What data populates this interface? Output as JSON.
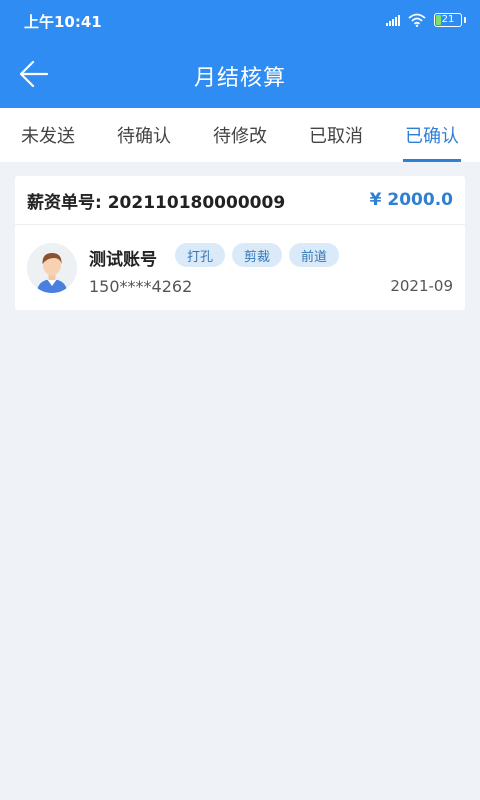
{
  "status_bar": {
    "time": "上午10:41",
    "battery": "21",
    "icons": [
      "signal-icon",
      "wifi-icon",
      "battery-icon"
    ],
    "battery_fill_fraction": 0.21
  },
  "header": {
    "title": "月结核算",
    "back_icon": "arrow-left-icon"
  },
  "tabs": [
    {
      "label": "未发送",
      "active": false
    },
    {
      "label": "待确认",
      "active": false
    },
    {
      "label": "待修改",
      "active": false
    },
    {
      "label": "已取消",
      "active": false
    },
    {
      "label": "已确认",
      "active": true
    }
  ],
  "records": [
    {
      "order_label": "薪资单号: 202110180000009",
      "amount": "¥ 2000.0",
      "user_name": "测试账号",
      "tags": [
        "打孔",
        "剪裁",
        "前道"
      ],
      "phone": "150****4262",
      "date": "2021-09"
    }
  ],
  "colors": {
    "primary": "#2f8cf3",
    "accent": "#2f7fd3",
    "background": "#eff3f7",
    "tag_bg": "#dbeaf9",
    "tag_text": "#3577b5"
  }
}
